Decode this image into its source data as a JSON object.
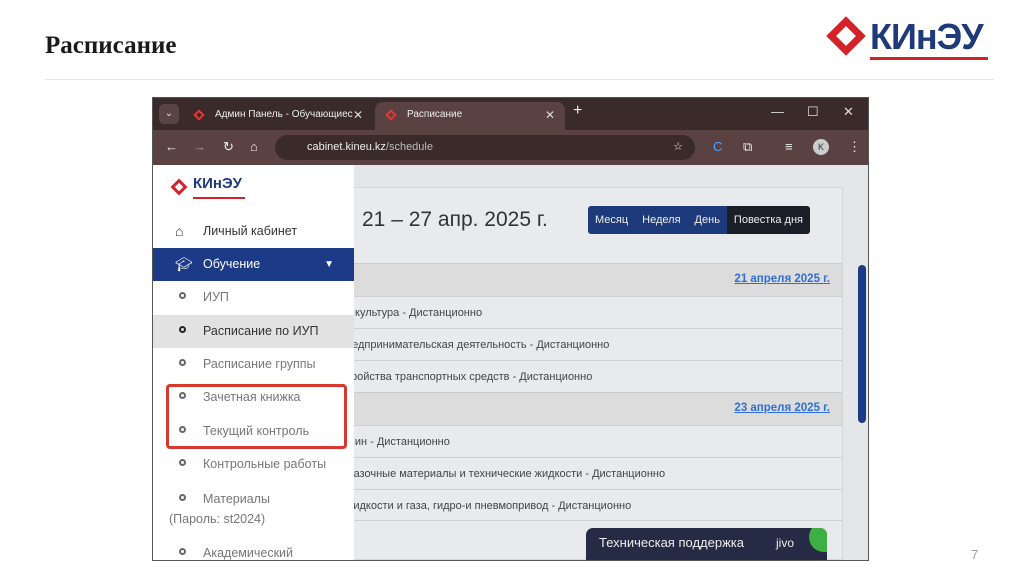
{
  "slide": {
    "title": "Расписание",
    "logo_text": "КИнЭУ",
    "page_number": "7"
  },
  "browser": {
    "tabs": [
      {
        "label": "Админ Панель - Обучающиес"
      },
      {
        "label": "Расписание"
      }
    ],
    "url_host": "cabinet.kineu.kz",
    "url_path": "/schedule"
  },
  "sidebar": {
    "logo_text": "КИнЭУ",
    "items": [
      {
        "label": "Личный кабинет",
        "icon": "home-icon"
      },
      {
        "label": "Обучение",
        "icon": "graduation-cap-icon"
      }
    ],
    "subitems": [
      {
        "label": "ИУП"
      },
      {
        "label": "Расписание по ИУП"
      },
      {
        "label": "Расписание группы"
      },
      {
        "label": "Зачетная книжка"
      },
      {
        "label": "Текущий контроль"
      },
      {
        "label": "Контрольные работы"
      },
      {
        "label": "Материалы"
      },
      {
        "label": "(Пароль: st2024)"
      },
      {
        "label": "Академический"
      }
    ]
  },
  "schedule": {
    "range": "21 – 27 апр. 2025 г.",
    "views": [
      "Месяц",
      "Неделя",
      "День",
      "Повестка дня"
    ],
    "days": [
      {
        "date": "21 апреля 2025 г.",
        "events": [
          "я культура - Дистанционно",
          "редпринимательская деятельность - Дистанционно",
          "тройства транспортных средств - Дистанционно"
        ]
      },
      {
        "date": "23 апреля 2025 г.",
        "events": [
          "шин - Дистанционно",
          "мазочные материалы и технические жидкости - Дистанционно",
          "жидкости и газа, гидро-и пневмопривод - Дистанционно"
        ]
      }
    ]
  },
  "support": {
    "label": "Техническая поддержка",
    "brand": "jivo"
  }
}
